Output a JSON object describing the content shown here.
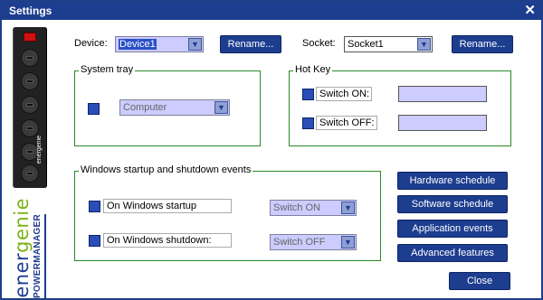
{
  "window": {
    "title": "Settings",
    "close_glyph": "✕"
  },
  "device": {
    "label": "Device:",
    "value": "Device1",
    "rename_label": "Rename..."
  },
  "socket": {
    "label": "Socket:",
    "value": "Socket1",
    "rename_label": "Rename..."
  },
  "system_tray": {
    "title": "System tray",
    "select_value": "Computer"
  },
  "hot_key": {
    "title": "Hot Key",
    "switch_on_label": "Switch ON:",
    "switch_off_label": "Switch OFF:",
    "switch_on_value": "",
    "switch_off_value": ""
  },
  "windows_events": {
    "title": "Windows startup and shutdown events",
    "startup_label": "On Windows startup",
    "startup_value": "Switch ON",
    "shutdown_label": "On Windows shutdown:",
    "shutdown_value": "Switch OFF"
  },
  "side_buttons": {
    "hardware": "Hardware schedule",
    "software": "Software schedule",
    "application": "Application events",
    "advanced": "Advanced features"
  },
  "close_button": "Close",
  "brand": {
    "line1_a": "ener",
    "line1_b": "genie",
    "line2": "POWERMANAGER",
    "strip_text": "energenie"
  },
  "icons": {
    "dropdown": "chevron-down-icon"
  },
  "colors": {
    "accent": "#1d3d8f",
    "field": "#ccccff",
    "group_border": "#2a8a2a"
  }
}
